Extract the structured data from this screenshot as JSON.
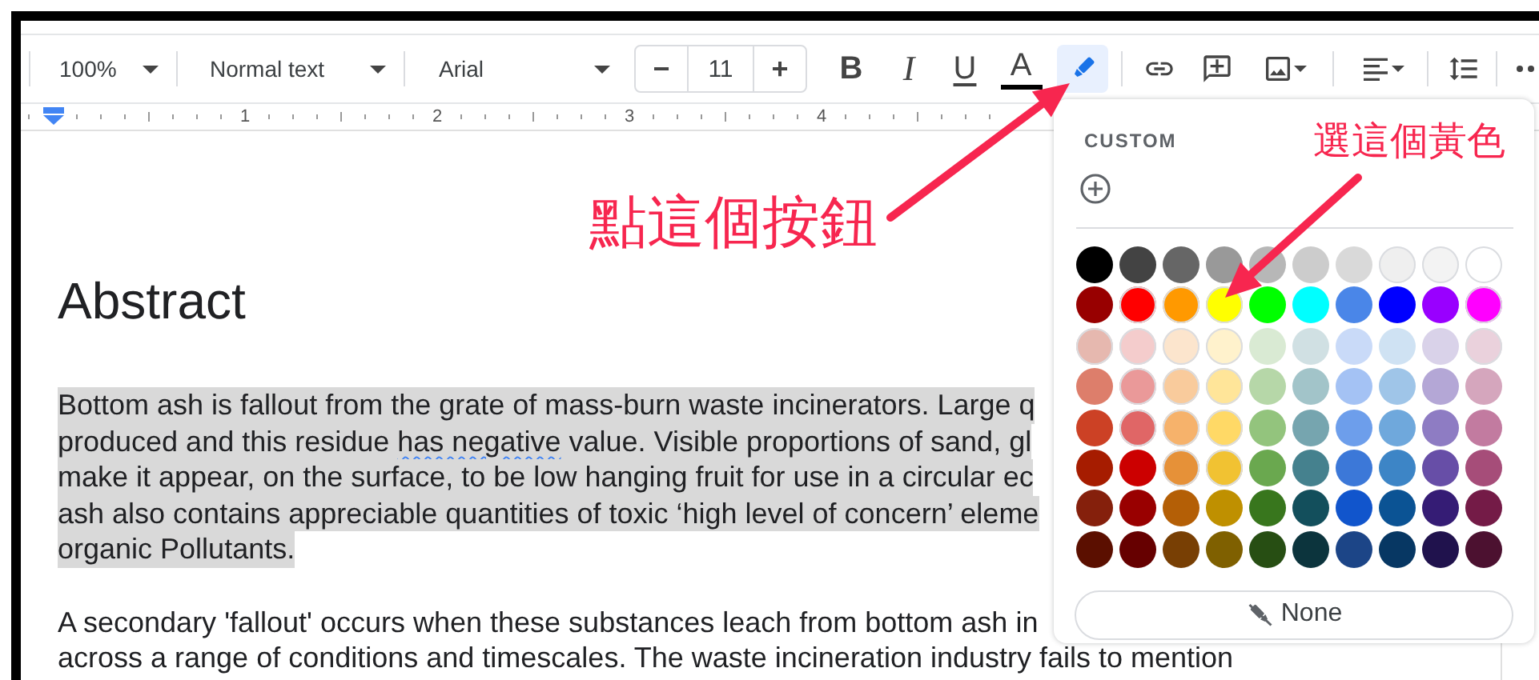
{
  "toolbar": {
    "zoom": "100%",
    "paragraph_style": "Normal text",
    "font": "Arial",
    "size_down": "−",
    "font_size": "11",
    "size_up": "+",
    "format_buttons": [
      {
        "kind": "bold",
        "label": "B"
      },
      {
        "kind": "italic",
        "label": "I"
      },
      {
        "kind": "underline",
        "label": "U"
      },
      {
        "kind": "text-color",
        "label": "A"
      }
    ],
    "tools": [
      {
        "kind": "highlight",
        "pressed": true
      },
      {
        "kind": "link",
        "pressed": false
      },
      {
        "kind": "comment",
        "pressed": false
      },
      {
        "kind": "image",
        "pressed": false
      },
      {
        "kind": "align",
        "pressed": false
      },
      {
        "kind": "line-spacing",
        "pressed": false
      },
      {
        "kind": "more",
        "pressed": false
      }
    ]
  },
  "ruler": {
    "marks": [
      "1",
      "2",
      "3",
      "4"
    ]
  },
  "document": {
    "heading": "Abstract",
    "paragraphs": [
      {
        "highlighted": true,
        "lines": [
          [
            {
              "text": "Bottom ash is fallout from the grate of mass-burn waste incinerators. Large q",
              "flagged": false
            }
          ],
          [
            {
              "text": "produced and this residue ",
              "flagged": false
            },
            {
              "text": "has negative",
              "flagged": true
            },
            {
              "text": " value. Visible proportions of sand, gl",
              "flagged": false
            }
          ],
          [
            {
              "text": "make it appear, on the surface, to be low hanging fruit for use in a circular ec",
              "flagged": false
            }
          ],
          [
            {
              "text": "ash also contains appreciable quantities of toxic ‘high level of concern’ eleme",
              "flagged": false
            }
          ],
          [
            {
              "text": "organic Pollutants.",
              "flagged": false
            }
          ]
        ]
      },
      {
        "highlighted": false,
        "lines": [
          [
            {
              "text": "A secondary 'fallout' occurs when these substances leach from bottom ash in",
              "flagged": false
            }
          ],
          [
            {
              "text": "across a range of conditions and timescales. The waste incineration industry fails to mention",
              "flagged": false
            }
          ]
        ]
      }
    ]
  },
  "highlight_menu": {
    "custom_label": "CUSTOM",
    "none_label": "None",
    "swatch_rows": [
      [
        {
          "color": "#000000"
        },
        {
          "color": "#434343"
        },
        {
          "color": "#666666"
        },
        {
          "color": "#999999"
        },
        {
          "color": "#b7b7b7"
        },
        {
          "color": "#cccccc"
        },
        {
          "color": "#d9d9d9"
        },
        {
          "color": "#efefef"
        },
        {
          "color": "#f3f3f3"
        },
        {
          "color": "#ffffff"
        }
      ],
      [
        {
          "color": "#980000"
        },
        {
          "color": "#ff0000"
        },
        {
          "color": "#ff9900"
        },
        {
          "color": "#ffff00"
        },
        {
          "color": "#00ff00"
        },
        {
          "color": "#00ffff"
        },
        {
          "color": "#4a86e8"
        },
        {
          "color": "#0000ff"
        },
        {
          "color": "#9900ff"
        },
        {
          "color": "#ff00ff"
        }
      ],
      [
        {
          "color": "#e6b8af"
        },
        {
          "color": "#f4cccc"
        },
        {
          "color": "#fce5cd"
        },
        {
          "color": "#fff2cc"
        },
        {
          "color": "#d9ead3"
        },
        {
          "color": "#d0e0e3"
        },
        {
          "color": "#c9daf8"
        },
        {
          "color": "#cfe2f3"
        },
        {
          "color": "#d9d2e9"
        },
        {
          "color": "#ead1dc"
        }
      ],
      [
        {
          "color": "#dd7e6b"
        },
        {
          "color": "#ea9999"
        },
        {
          "color": "#f9cb9c"
        },
        {
          "color": "#ffe599"
        },
        {
          "color": "#b6d7a8"
        },
        {
          "color": "#a2c4c9"
        },
        {
          "color": "#a4c2f4"
        },
        {
          "color": "#9fc5e8"
        },
        {
          "color": "#b4a7d6"
        },
        {
          "color": "#d5a6bd"
        }
      ],
      [
        {
          "color": "#cc4125"
        },
        {
          "color": "#e06666"
        },
        {
          "color": "#f6b26b"
        },
        {
          "color": "#ffd966"
        },
        {
          "color": "#93c47d"
        },
        {
          "color": "#76a5af"
        },
        {
          "color": "#6d9eeb"
        },
        {
          "color": "#6fa8dc"
        },
        {
          "color": "#8e7cc3"
        },
        {
          "color": "#c27ba0"
        }
      ],
      [
        {
          "color": "#a61c00"
        },
        {
          "color": "#cc0000"
        },
        {
          "color": "#e69138"
        },
        {
          "color": "#f1c232"
        },
        {
          "color": "#6aa84f"
        },
        {
          "color": "#45818e"
        },
        {
          "color": "#3c78d8"
        },
        {
          "color": "#3d85c6"
        },
        {
          "color": "#674ea7"
        },
        {
          "color": "#a64d79"
        }
      ],
      [
        {
          "color": "#85200c"
        },
        {
          "color": "#990000"
        },
        {
          "color": "#b45f06"
        },
        {
          "color": "#bf9000"
        },
        {
          "color": "#38761d"
        },
        {
          "color": "#134f5c"
        },
        {
          "color": "#1155cc"
        },
        {
          "color": "#0b5394"
        },
        {
          "color": "#351c75"
        },
        {
          "color": "#741b47"
        }
      ],
      [
        {
          "color": "#5b0f00"
        },
        {
          "color": "#660000"
        },
        {
          "color": "#783f04"
        },
        {
          "color": "#7f6000"
        },
        {
          "color": "#274e13"
        },
        {
          "color": "#0c343d"
        },
        {
          "color": "#1c4587"
        },
        {
          "color": "#073763"
        },
        {
          "color": "#20124d"
        },
        {
          "color": "#4c1130"
        }
      ]
    ]
  },
  "annotations": [
    {
      "kind": "button-note",
      "text": "點這個按鈕"
    },
    {
      "kind": "color-note",
      "text": "選這個黃色"
    }
  ]
}
